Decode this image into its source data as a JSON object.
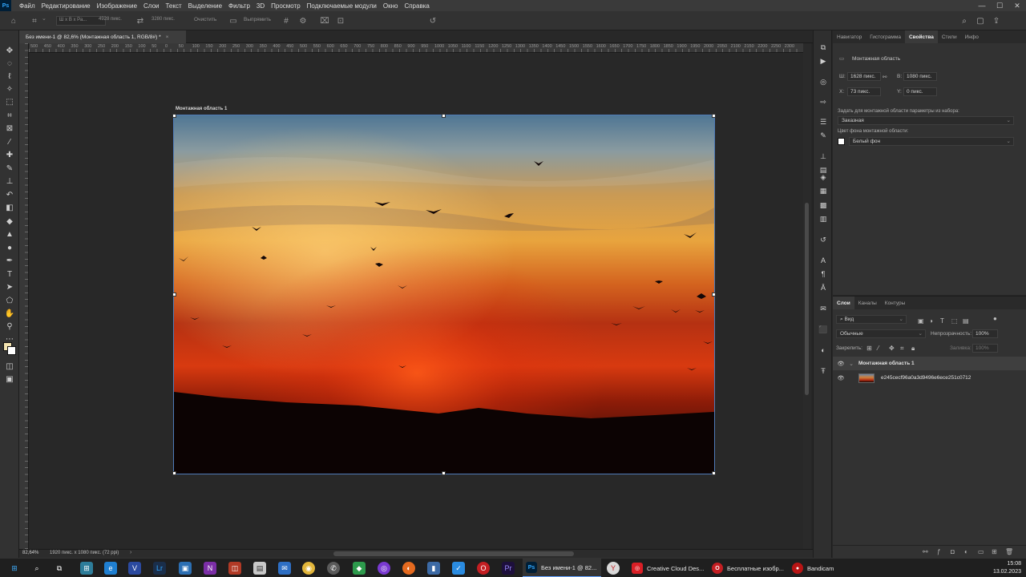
{
  "app": {
    "logo_text": "Ps"
  },
  "menu": [
    "Файл",
    "Редактирование",
    "Изображение",
    "Слои",
    "Текст",
    "Выделение",
    "Фильтр",
    "3D",
    "Просмотр",
    "Подключаемые модули",
    "Окно",
    "Справка"
  ],
  "window_controls": {
    "minimize": "—",
    "maximize": "☐",
    "close": "✕"
  },
  "options_bar": {
    "ratio_field": "Ш x В x Ра...",
    "width_field": "4928 пикс.",
    "height_field": "3280 пикс.",
    "clear_button": "Очистить",
    "straighten_button": "Выпрямить"
  },
  "document": {
    "tab_title": "Без имени-1 @ 82,6% (Монтажная область 1, RGB/8#) *",
    "close": "×",
    "artboard_label": "Монтажная область 1",
    "ruler_labels": [
      "500",
      "450",
      "400",
      "350",
      "300",
      "250",
      "200",
      "150",
      "100",
      "50",
      "0",
      "50",
      "100",
      "150",
      "200",
      "250",
      "300",
      "350",
      "400",
      "450",
      "500",
      "550",
      "600",
      "650",
      "700",
      "750",
      "800",
      "850",
      "900",
      "950",
      "1000",
      "1050",
      "1100",
      "1150",
      "1200",
      "1250",
      "1300",
      "1350",
      "1400",
      "1450",
      "1500",
      "1550",
      "1600",
      "1650",
      "1700",
      "1750",
      "1800",
      "1850",
      "1900",
      "1950",
      "2000",
      "2050",
      "2100",
      "2150",
      "2200",
      "2250",
      "2300"
    ]
  },
  "status": {
    "zoom": "82,64%",
    "doc_size": "1920 пикс. x 1080 пикс. (72 ppi)",
    "arrow": "›"
  },
  "properties_panel": {
    "tabs": [
      "Навигатор",
      "Гистограмма",
      "Свойства",
      "Стили",
      "Инфо"
    ],
    "active_tab": "Свойства",
    "section_title": "Монтажная область",
    "w_label": "Ш:",
    "w_value": "1628 пикс.",
    "link_label": "⚯",
    "h_label": "В:",
    "h_value": "1080 пикс.",
    "x_label": "X:",
    "x_value": "73 пикс.",
    "y_label": "Y:",
    "y_value": "0 пикс.",
    "preset_label": "Задать для монтажной области параметры из набора:",
    "preset_value": "Заказная",
    "bg_label": "Цвет фона монтажной области:",
    "bg_value": "Белый фон"
  },
  "layers_panel": {
    "tabs": [
      "Слои",
      "Каналы",
      "Контуры"
    ],
    "active_tab": "Слои",
    "filter_value": "Вид",
    "blend_mode": "Обычные",
    "opacity_label": "Непрозрачность:",
    "opacity_value": "100%",
    "lock_label": "Закрепить:",
    "fill_label": "Заливка:",
    "fill_value": "100%",
    "layers": [
      {
        "name": "Монтажная область 1",
        "kind": "artboard"
      },
      {
        "name": "e245cecf96a0a3d9496e6ece251c0712",
        "kind": "image"
      }
    ]
  },
  "taskbar": {
    "apps": [
      {
        "label": "Без имени-1 @ 82...",
        "badge": "Ps",
        "color": "#001e36"
      },
      {
        "label": "Creative Cloud Des...",
        "badge": "◎",
        "color": "#da1f26"
      },
      {
        "label": "Бесплатные изобр...",
        "badge": "O",
        "color": "#c41e22"
      },
      {
        "label": "Bandicam",
        "badge": "●",
        "color": "#b81414"
      }
    ],
    "time": "15:08",
    "date": "13.02.2023"
  },
  "colors": {
    "accent": "#31a8ff",
    "artboard_outline": "#4f7bb8",
    "foreground_swatch": "#f3e3b0",
    "background_swatch": "#ffffff"
  },
  "icons": [
    "home-icon",
    "crop-icon",
    "swap-icon",
    "grid-icon",
    "gear-icon",
    "reset-icon",
    "search-icon",
    "workspace-icon",
    "share-icon"
  ]
}
